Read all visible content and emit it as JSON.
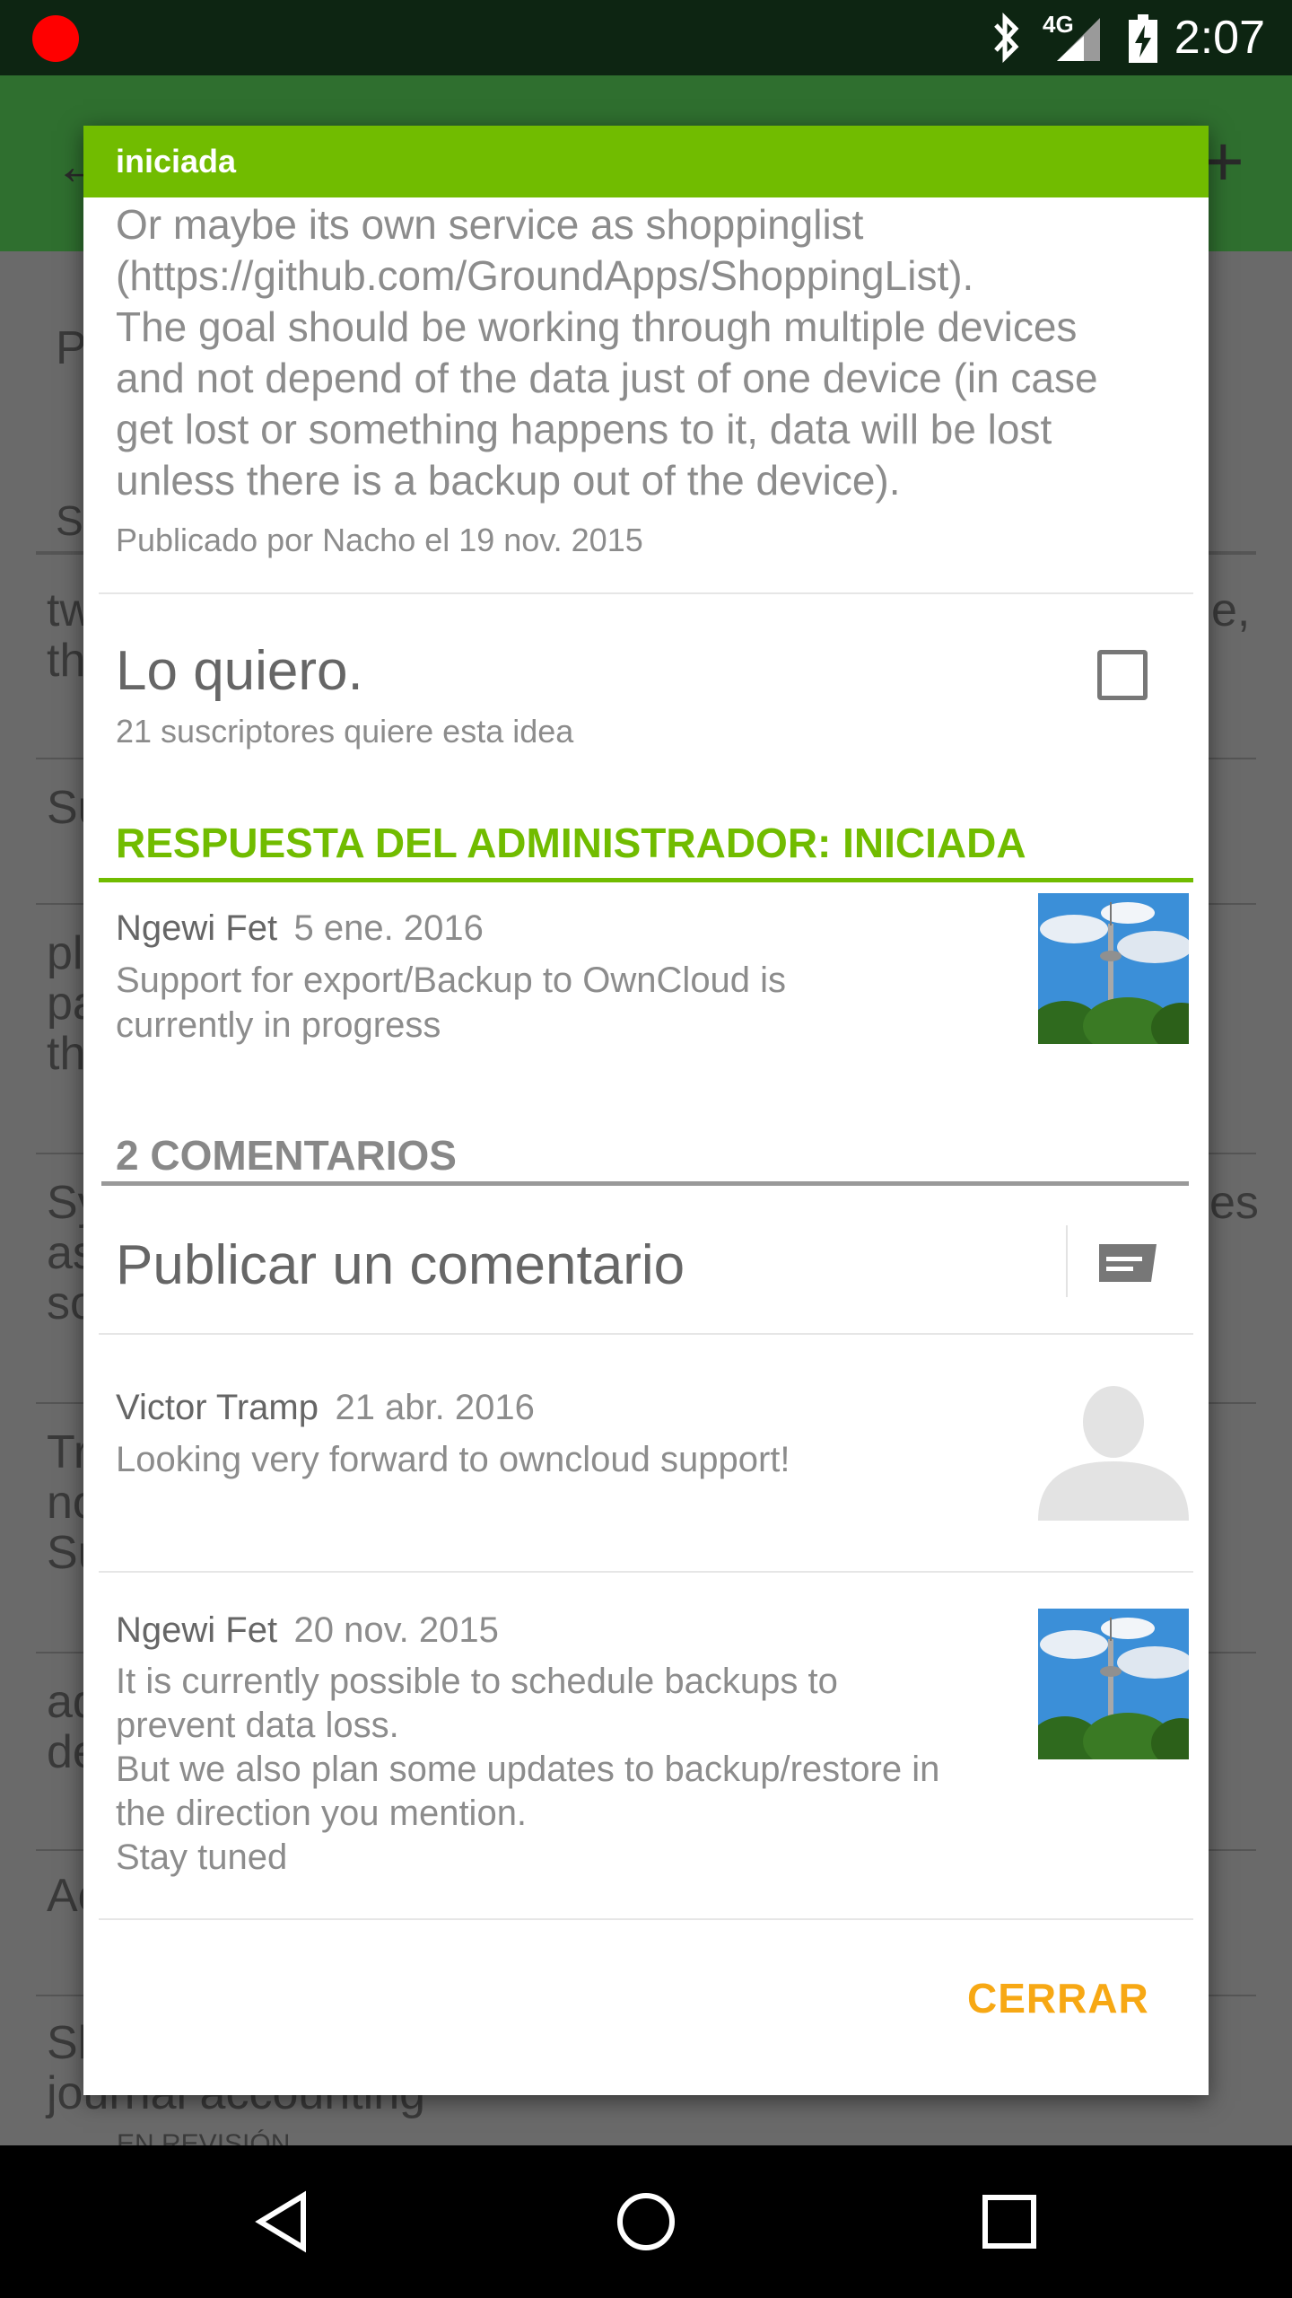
{
  "status_bar": {
    "time": "2:07",
    "network": "4G",
    "icons": [
      "record-dot-icon",
      "bluetooth-icon",
      "signal-icon",
      "battery-charging-icon"
    ]
  },
  "background_list": {
    "items_fragments": [
      "P",
      "S",
      "tw",
      "th",
      "Su",
      "pl",
      "pa",
      "th",
      "Sy",
      "as",
      "so",
      "Tr",
      "no",
      "Su",
      "ad",
      "de",
      "Ac",
      "Sh",
      "journal accounting",
      "EN REVISIÓN"
    ],
    "right_fragments": [
      "e,",
      "es"
    ]
  },
  "dialog": {
    "status_title": "iniciada",
    "description_lines": [
      "Or maybe its own service as shoppinglist",
      "(https://github.com/GroundApps/ShoppingList).",
      "The goal should be working through multiple devices",
      "and not depend of the data just of one device (in case",
      "get lost or something happens to it, data will be lost",
      "unless there is a backup out of the device)."
    ],
    "published_by": "Publicado por Nacho el 19 nov. 2015",
    "want": {
      "title": "Lo quiero.",
      "subscribers": "21 suscriptores quiere esta idea",
      "checked": false
    },
    "admin_response": {
      "heading": "RESPUESTA DEL ADMINISTRADOR: INICIADA",
      "author": "Ngewi Fet",
      "date": "5 ene. 2016",
      "lines": [
        "Support for export/Backup to OwnCloud is",
        "currently in progress"
      ]
    },
    "comments_heading": "2 COMENTARIOS",
    "post_comment_label": "Publicar un comentario",
    "comments": [
      {
        "author": "Victor Tramp",
        "date": "21 abr. 2016",
        "lines": [
          "Looking very forward to owncloud support!"
        ],
        "avatar": "default-person-avatar"
      },
      {
        "author": "Ngewi Fet",
        "date": "20 nov. 2015",
        "lines": [
          "It is currently possible to schedule backups to",
          "prevent data loss.",
          "But we also plan some updates to backup/restore in",
          "the direction you mention.",
          "Stay tuned"
        ],
        "avatar": "tower-photo-avatar"
      }
    ],
    "close_label": "CERRAR"
  },
  "nav_bar": {
    "icons": [
      "back-triangle-icon",
      "home-circle-icon",
      "recents-square-icon"
    ]
  },
  "colors": {
    "accent_green": "#71bc00",
    "close_orange": "#f7a814",
    "status_bar": "#0d2512"
  }
}
